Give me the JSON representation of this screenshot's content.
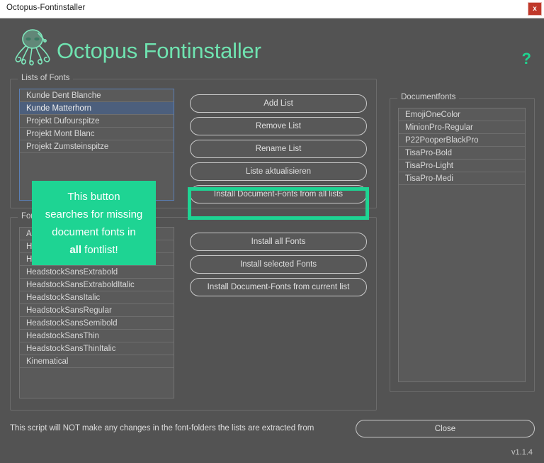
{
  "window": {
    "title": "Octopus-Fontinstaller",
    "close_icon": "close-x-icon",
    "close_label": "x"
  },
  "header": {
    "app_title": "Octopus Fontinstaller",
    "logo_icon": "octopus-logo-icon",
    "help_label": "?",
    "accent_color": "#1ed493",
    "title_color": "#6fe3b0"
  },
  "lists_group": {
    "legend": "Lists of Fonts",
    "items": [
      {
        "label": "Kunde Dent Blanche",
        "selected": false
      },
      {
        "label": "Kunde Matterhorn",
        "selected": true
      },
      {
        "label": "Projekt Dufourspitze",
        "selected": false
      },
      {
        "label": "Projekt Mont Blanc",
        "selected": false
      },
      {
        "label": "Projekt Zumsteinspitze",
        "selected": false
      }
    ],
    "buttons": {
      "add_list": "Add List",
      "remove_list": "Remove List",
      "rename_list": "Rename List",
      "update_list": "Liste aktualisieren",
      "install_doc_all_lists": "Install Document-Fonts from all lists"
    }
  },
  "fonts_group": {
    "legend": "Fonts",
    "items": [
      {
        "label": "Artl"
      },
      {
        "label": "HeadstockSansBold"
      },
      {
        "label": "HeadstockSansBoldItalic"
      },
      {
        "label": "HeadstockSansExtrabold"
      },
      {
        "label": "HeadstockSansExtraboldItalic"
      },
      {
        "label": "HeadstockSansItalic"
      },
      {
        "label": "HeadstockSansRegular"
      },
      {
        "label": "HeadstockSansSemibold"
      },
      {
        "label": "HeadstockSansThin"
      },
      {
        "label": "HeadstockSansThinItalic"
      },
      {
        "label": "Kinematical"
      }
    ],
    "buttons": {
      "install_all_fonts": "Install all Fonts",
      "install_selected_fonts": "Install selected Fonts",
      "install_doc_current_list": "Install Document-Fonts from current list"
    }
  },
  "documentfonts_group": {
    "legend": "Documentfonts",
    "items": [
      {
        "label": "EmojiOneColor"
      },
      {
        "label": "MinionPro-Regular"
      },
      {
        "label": "P22PooperBlackPro"
      },
      {
        "label": "TisaPro-Bold"
      },
      {
        "label": "TisaPro-Light"
      },
      {
        "label": "TisaPro-Medi"
      }
    ]
  },
  "callout": {
    "line1": "This button",
    "line2": "searches for missing",
    "line3": "document fonts in",
    "line4_bold": "all",
    "line4_rest": " fontlist!",
    "background_color": "#1ed493"
  },
  "footer": {
    "note": "This script will NOT make any changes in the font-folders the lists are extracted from",
    "close_label": "Close",
    "version": "v1.1.4"
  }
}
